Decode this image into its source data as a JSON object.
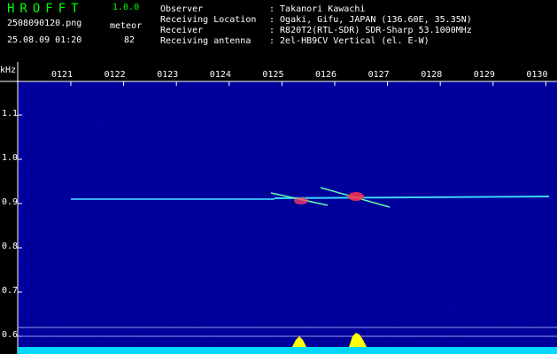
{
  "header": {
    "app_name": "HROFFT",
    "app_version": "1.0.0",
    "filename": "2508090120.png",
    "meteor_label": "meteor",
    "datetime": "25.08.09 01:20",
    "meteor_count": "82",
    "info": [
      {
        "label": "Observer",
        "value": ": Takanori Kawachi"
      },
      {
        "label": "Receiving Location",
        "value": ": Ogaki, Gifu, JAPAN (136.60E, 35.35N)"
      },
      {
        "label": "Receiver",
        "value": ": R820T2(RTL-SDR) SDR-Sharp 53.1000MHz"
      },
      {
        "label": "Receiving antenna",
        "value": ": 2el-HB9CV Vertical (el. E-W)"
      }
    ]
  },
  "spectrogram": {
    "y_unit": "kHz",
    "x_ticks": [
      "0121",
      "0122",
      "0123",
      "0124",
      "0125",
      "0126",
      "0127",
      "0128",
      "0129",
      "0130"
    ],
    "y_ticks": [
      "1.1",
      "1.0",
      "0.9",
      "0.8",
      "0.7",
      "0.6"
    ],
    "colors": {
      "background": "#000080",
      "trace": "#40e0ff",
      "bottom_bar": "#00d8ff",
      "burst": "#ffff00"
    }
  }
}
